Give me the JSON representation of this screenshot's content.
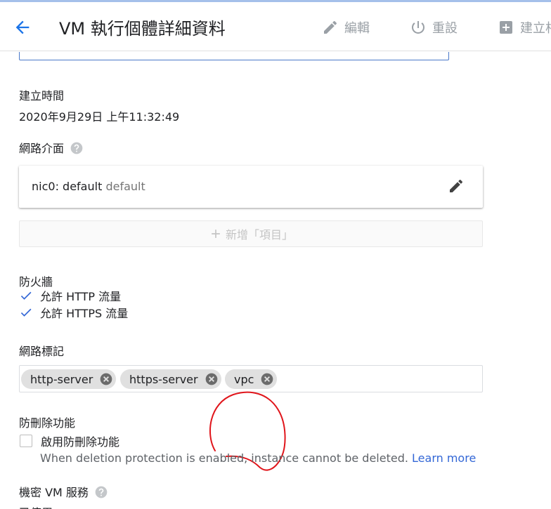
{
  "header": {
    "title": "VM 執行個體詳細資料",
    "actions": [
      {
        "label": "編輯",
        "icon": "pencil-icon"
      },
      {
        "label": "重設",
        "icon": "power-icon"
      },
      {
        "label": "建立相",
        "icon": "add-box-icon"
      }
    ]
  },
  "created": {
    "label": "建立時間",
    "value": "2020年9月29日 上午11:32:49"
  },
  "network_interfaces": {
    "label": "網路介面",
    "nic": {
      "name": "nic0: default",
      "network": "default"
    },
    "add_label": "新增「項目」"
  },
  "firewall": {
    "label": "防火牆",
    "options": [
      {
        "label": "允許 HTTP 流量",
        "checked": true
      },
      {
        "label": "允許 HTTPS 流量",
        "checked": true
      }
    ]
  },
  "network_tags": {
    "label": "網路標記",
    "tags": [
      "http-server",
      "https-server",
      "vpc"
    ]
  },
  "deletion_protection": {
    "label": "防刪除功能",
    "checkbox_label": "啟用防刪除功能",
    "checked": false,
    "description": "When deletion protection is enabled, instance cannot be deleted.",
    "learn_more": "Learn more"
  },
  "confidential_vm": {
    "label": "機密 VM 服務",
    "value": "已停用"
  },
  "colors": {
    "accent": "#1a73e8",
    "checkbox": "#3367d6",
    "annotation": "#e0151b"
  }
}
